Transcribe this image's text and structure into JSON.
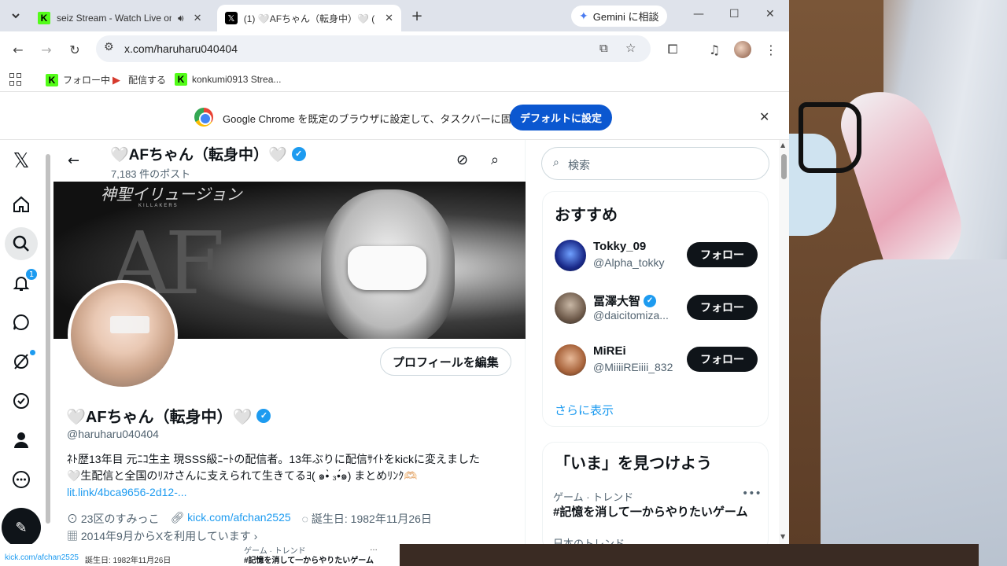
{
  "tabs": [
    {
      "label": "seiz Stream - Watch Live on",
      "icon": "kick-favicon"
    },
    {
      "label": "(1) 🤍AFちゃん（転身中）🤍 (",
      "icon": "x-favicon"
    }
  ],
  "gemini": {
    "label": "Gemini に相談"
  },
  "omnibox": {
    "url": "x.com/haruharu040404"
  },
  "bookmarks": [
    {
      "label": "フォロー中"
    },
    {
      "label": "配信する"
    },
    {
      "label": "konkumi0913 Strea..."
    }
  ],
  "infobar": {
    "message": "Google Chrome を既定のブラウザに設定して、タスクバーに固定する",
    "button": "デフォルトに設定"
  },
  "nav": {
    "notification_count": "1"
  },
  "profile_header": {
    "name": "🤍AFちゃん（転身中）🤍",
    "posts": "7,183 件のポスト"
  },
  "banner": {
    "logo": "神聖イリュージョン",
    "sub": "KILLAKERS",
    "big": "AF"
  },
  "profile": {
    "edit_button": "プロフィールを編集",
    "name": "🤍AFちゃん（転身中）🤍",
    "handle": "@haruharu040404",
    "bio_line1": "ﾈﾄ歴13年目 元ﾆｺ生主 現SSS級ﾆｰﾄの配信者。13年ぶりに配信ｻｲﾄをkickに変えました",
    "bio_line2": "🤍生配信と全国のﾘｽﾅさんに支えられて生きてるﾖ( ๑•̀ ₃•́๑) まとめﾘﾝｸ🫶🏻",
    "bio_link": "lit.link/4bca9656-2d12-...",
    "location": "23区のすみっこ",
    "website": "kick.com/afchan2525",
    "birthday": "誕生日: 1982年11月26日",
    "joined": "2014年9月からXを利用しています"
  },
  "sidebar": {
    "search_placeholder": "検索",
    "recommend_title": "おすすめ",
    "users": [
      {
        "name": "Tokky_09",
        "handle": "@Alpha_tokky",
        "verified": false,
        "follow": "フォロー"
      },
      {
        "name": "冨澤大智",
        "handle": "@daicitomiza...",
        "verified": true,
        "follow": "フォロー"
      },
      {
        "name": "MiREi",
        "handle": "@MiiiiREiiii_832",
        "verified": false,
        "follow": "フォロー"
      }
    ],
    "show_more": "さらに表示",
    "discover_title": "「いま」を見つけよう",
    "trend_category": "ゲーム · トレンド",
    "trend_name": "#記憶を消して一からやりたいゲーム",
    "trend_category2": "日本のトレンド"
  },
  "bottom_strip": {
    "link": "kick.com/afchan2525",
    "birthday": "誕生日: 1982年11月26日",
    "trend_category": "ゲーム · トレンド",
    "trend_name": "#記憶を消して一からやりたいゲーム"
  },
  "colors": {
    "accent": "#1d9bf0",
    "chrome_blue": "#0b57d0",
    "text": "#0f1419",
    "muted": "#536471"
  }
}
